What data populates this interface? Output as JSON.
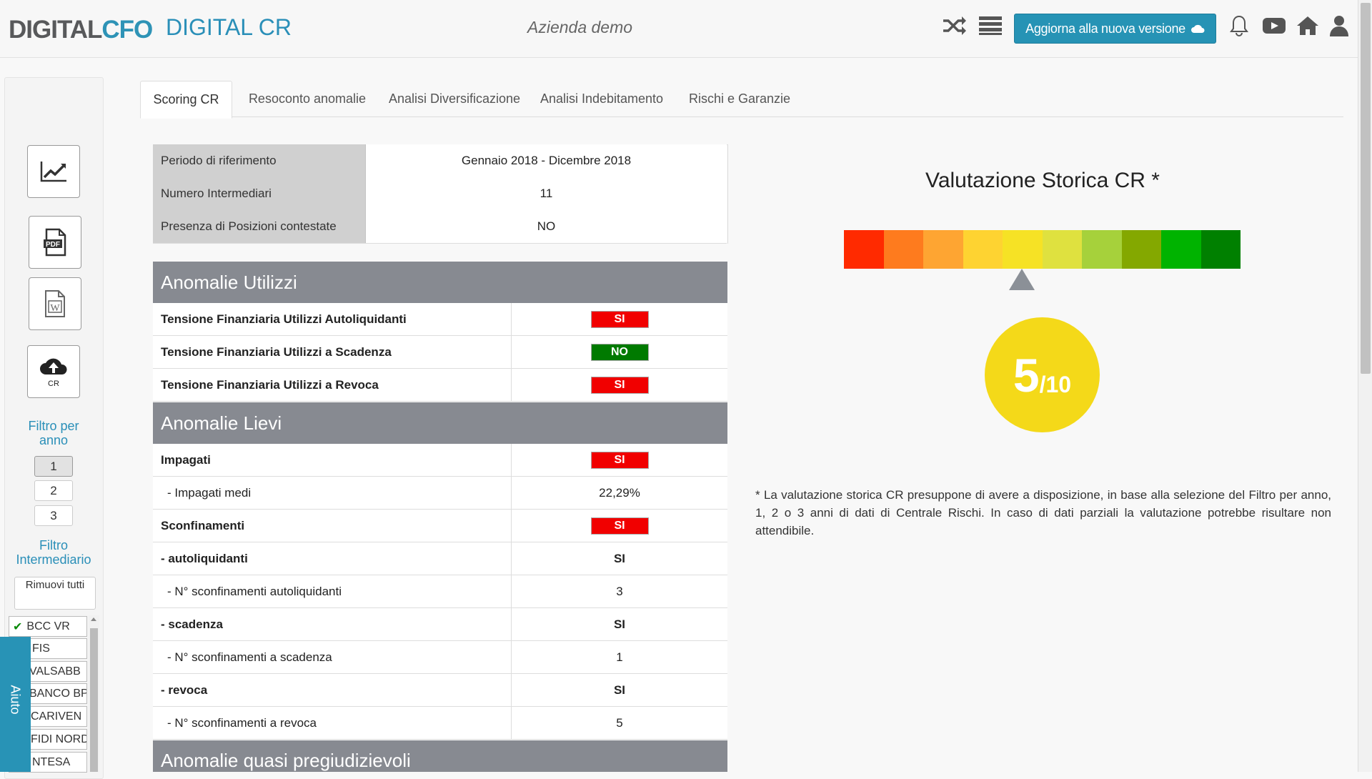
{
  "header": {
    "logo_part1": "DIGITAL",
    "logo_part2": "CFO",
    "app_title": "DIGITAL CR",
    "company": "Azienda demo",
    "upgrade_label": "Aggiorna alla nuova versione"
  },
  "sidebar": {
    "cr_label": "CR",
    "year_filter_label": "Filtro per anno",
    "years": [
      "1",
      "2",
      "3"
    ],
    "active_year": "1",
    "intermediary_filter_label": "Filtro Intermediario",
    "remove_all_label": "Rimuovi tutti",
    "intermediaries": [
      "BCC VR",
      "FIS",
      "VALSABB",
      "BANCO BP",
      "CARIVEN",
      "FIDI NORD",
      "NTESA"
    ],
    "help_label": "Aiuto"
  },
  "tabs": [
    "Scoring CR",
    "Resoconto anomalie",
    "Analisi Diversificazione",
    "Analisi Indebitamento",
    "Rischi e Garanzie"
  ],
  "info": [
    {
      "key": "Periodo di riferimento",
      "value": "Gennaio 2018 - Dicembre 2018"
    },
    {
      "key": "Numero Intermediari",
      "value": "11"
    },
    {
      "key": "Presenza di Posizioni contestate",
      "value": "NO"
    }
  ],
  "sections": {
    "utilizzi": {
      "title": "Anomalie Utilizzi",
      "rows": [
        {
          "label": "Tensione Finanziaria Utilizzi Autoliquidanti",
          "value": "SI"
        },
        {
          "label": "Tensione Finanziaria Utilizzi a Scadenza",
          "value": "NO"
        },
        {
          "label": "Tensione Finanziaria Utilizzi a Revoca",
          "value": "SI"
        }
      ]
    },
    "lievi": {
      "title": "Anomalie Lievi",
      "rows": [
        {
          "label": "Impagati",
          "value": "SI"
        },
        {
          "label": "- Impagati medi",
          "value": "22,29%"
        },
        {
          "label": "Sconfinamenti",
          "value": "SI"
        },
        {
          "label": "- autoliquidanti",
          "value": "SI"
        },
        {
          "label": "- N° sconfinamenti autoliquidanti",
          "value": "3"
        },
        {
          "label": "- scadenza",
          "value": "SI"
        },
        {
          "label": "- N° sconfinamenti a scadenza",
          "value": "1"
        },
        {
          "label": "- revoca",
          "value": "SI"
        },
        {
          "label": "- N° sconfinamenti a revoca",
          "value": "5"
        }
      ]
    },
    "quasi": {
      "title": "Anomalie quasi pregiudizievoli"
    }
  },
  "valutazione": {
    "title": "Valutazione Storica CR *",
    "score": "5",
    "max": "/10",
    "scale_colors": [
      "#ff2a00",
      "#fe7b1e",
      "#fea532",
      "#fed331",
      "#f6e225",
      "#dfe13f",
      "#a6d13b",
      "#84a800",
      "#00b300",
      "#008000"
    ],
    "note": "* La valutazione storica CR presuppone di avere a disposizione, in base alla selezione del Filtro per anno, 1, 2 o 3 anni di dati di Centrale Rischi. In caso di dati parziali la valutazione potrebbe risultare non attendibile."
  },
  "colors": {
    "accent": "#2693b5",
    "badge_si": "#f10000",
    "badge_no": "#007a00",
    "section_header": "#878a91",
    "score_circle": "#f4d919"
  }
}
